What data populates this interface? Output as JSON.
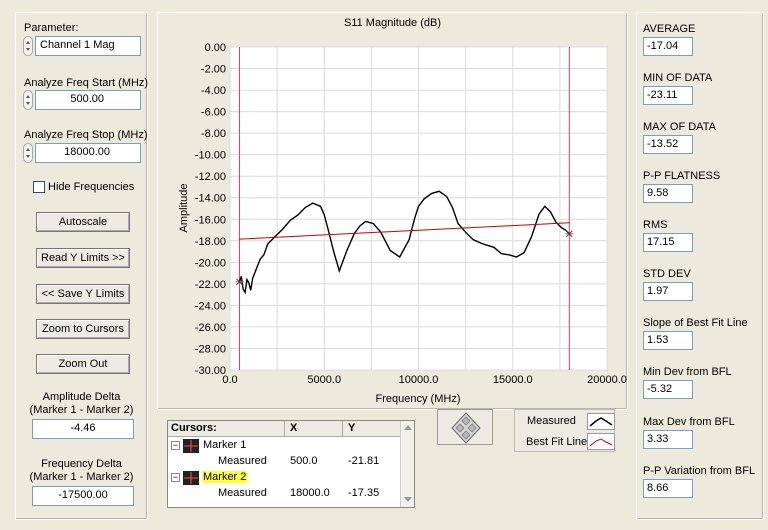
{
  "left_panel": {
    "parameter_label": "Parameter:",
    "parameter_value": "Channel 1 Mag",
    "freq_start_label": "Analyze Freq Start (MHz)",
    "freq_start_value": "500.00",
    "freq_stop_label": "Analyze Freq Stop (MHz)",
    "freq_stop_value": "18000.00",
    "hide_freq_label": "Hide Frequencies",
    "hide_freq_checked": false,
    "buttons": {
      "autoscale": "Autoscale",
      "read_y_limits": "Read Y Limits >>",
      "save_y_limits": "<< Save Y Limits",
      "zoom_to_cursors": "Zoom to Cursors",
      "zoom_out": "Zoom Out"
    },
    "amp_delta_label_1": "Amplitude Delta",
    "amp_delta_label_2": "(Marker 1 - Marker 2)",
    "amp_delta_value": "-4.46",
    "freq_delta_label_1": "Frequency Delta",
    "freq_delta_label_2": "(Marker 1 - Marker 2)",
    "freq_delta_value": "-17500.00"
  },
  "chart_data": {
    "type": "line",
    "title": "S11 Magnitude (dB)",
    "xlabel": "Frequency (MHz)",
    "ylabel": "Amplitude",
    "xlim": [
      0,
      20000
    ],
    "ylim": [
      -30,
      0
    ],
    "x_ticks": [
      "0.0",
      "5000.0",
      "10000.0",
      "15000.0",
      "20000.0"
    ],
    "y_ticks": [
      "0.00",
      "-2.00",
      "-4.00",
      "-6.00",
      "-8.00",
      "-10.00",
      "-12.00",
      "-14.00",
      "-16.00",
      "-18.00",
      "-20.00",
      "-22.00",
      "-24.00",
      "-26.00",
      "-28.00",
      "-30.00"
    ],
    "grid": true,
    "series": [
      {
        "name": "Measured",
        "color": "#000000",
        "x": [
          500,
          600,
          700,
          800,
          900,
          1000,
          1100,
          1200,
          1400,
          1600,
          1800,
          2000,
          2400,
          2800,
          3200,
          3600,
          4000,
          4400,
          4800,
          5000,
          5200,
          5500,
          5800,
          6200,
          6600,
          6900,
          7200,
          7600,
          8000,
          8500,
          9000,
          9500,
          9800,
          10000,
          10300,
          10700,
          11100,
          11500,
          11800,
          12100,
          12500,
          12900,
          13300,
          13600,
          14000,
          14400,
          14800,
          15200,
          15600,
          16000,
          16400,
          16700,
          17000,
          17300,
          17600,
          17800,
          18000
        ],
        "y": [
          -21.81,
          -21.3,
          -22.5,
          -22.8,
          -21.6,
          -21.9,
          -22.6,
          -21.5,
          -20.6,
          -19.7,
          -19.3,
          -18.3,
          -17.6,
          -16.9,
          -16.1,
          -15.6,
          -14.9,
          -14.5,
          -14.8,
          -15.6,
          -16.9,
          -19.0,
          -20.8,
          -18.9,
          -17.3,
          -16.6,
          -16.2,
          -16.4,
          -17.2,
          -18.9,
          -19.5,
          -17.9,
          -15.9,
          -14.8,
          -14.1,
          -13.6,
          -13.4,
          -13.9,
          -14.9,
          -16.4,
          -17.2,
          -17.9,
          -18.2,
          -18.4,
          -18.6,
          -19.2,
          -19.3,
          -19.5,
          -19.1,
          -17.6,
          -15.5,
          -14.8,
          -15.3,
          -16.3,
          -16.8,
          -17.0,
          -17.35
        ]
      },
      {
        "name": "Best Fit Line",
        "color": "#cc0000",
        "x": [
          500,
          18000
        ],
        "y": [
          -17.84,
          -16.33
        ]
      }
    ],
    "markers": [
      {
        "name": "Marker 1",
        "x": 500,
        "color": "#d0406a"
      },
      {
        "name": "Marker 2",
        "x": 18000,
        "color": "#d0406a"
      }
    ]
  },
  "legend": {
    "measured": "Measured",
    "best_fit": "Best Fit Line"
  },
  "cursors": {
    "header": "Cursors:",
    "col_x": "X",
    "col_y": "Y",
    "rows": [
      {
        "name": "Marker 1",
        "sub": "Measured",
        "x": "500.0",
        "y": "-21.81"
      },
      {
        "name": "Marker 2",
        "sub": "Measured",
        "x": "18000.0",
        "y": "-17.35"
      }
    ]
  },
  "stats": [
    {
      "label": "AVERAGE",
      "value": "-17.04"
    },
    {
      "label": "MIN OF DATA",
      "value": "-23.11"
    },
    {
      "label": "MAX OF DATA",
      "value": "-13.52"
    },
    {
      "label": "P-P FLATNESS",
      "value": "9.58"
    },
    {
      "label": "RMS",
      "value": "17.15"
    },
    {
      "label": "STD DEV",
      "value": "1.97"
    },
    {
      "label": "Slope of Best Fit Line",
      "value": "1.53"
    },
    {
      "label": "Min Dev from BFL",
      "value": "-5.32"
    },
    {
      "label": "Max Dev from BFL",
      "value": "3.33"
    },
    {
      "label": "P-P Variation from BFL",
      "value": "8.66"
    }
  ]
}
